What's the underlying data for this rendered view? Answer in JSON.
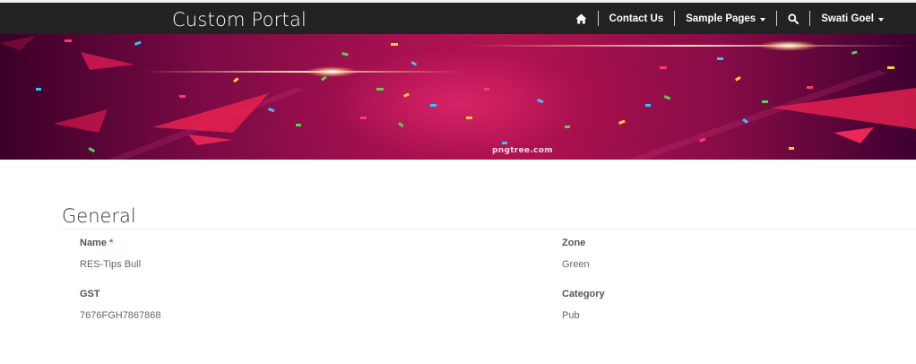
{
  "header": {
    "brand": "Custom Portal",
    "nav": [
      {
        "icon": "home-icon"
      },
      {
        "label": "Contact Us"
      },
      {
        "label": "Sample Pages",
        "dropdown": true
      },
      {
        "icon": "search-icon"
      },
      {
        "label": "Swati Goel",
        "dropdown": true
      }
    ]
  },
  "banner": {
    "watermark": "pngtree.com",
    "colors": {
      "dark": "#3a0028",
      "mid": "#a5134f",
      "glow": "#e6286e"
    }
  },
  "form": {
    "section_title": "General",
    "fields": [
      {
        "label": "Name",
        "required_marker": "*",
        "value": "RES-Tips Bull"
      },
      {
        "label": "Zone",
        "value": "Green"
      },
      {
        "label": "GST",
        "value": "7676FGH7867868"
      },
      {
        "label": "Category",
        "value": "Pub"
      }
    ]
  },
  "colors": {
    "topbar": "#222222",
    "text_label": "#555555",
    "text_value": "#666666",
    "required": "#d9534f"
  }
}
